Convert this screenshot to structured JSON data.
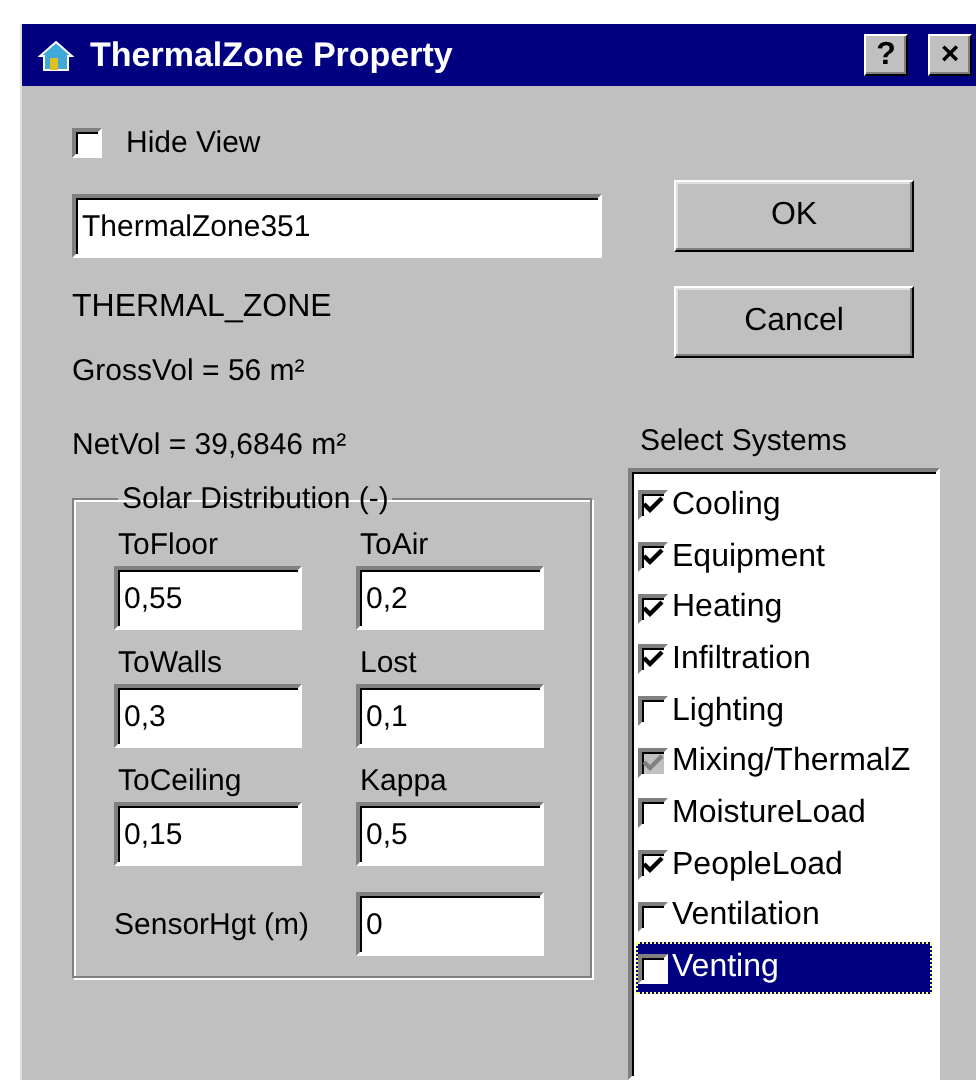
{
  "window": {
    "title": "ThermalZone Property",
    "help_button": "?",
    "close_button": "×"
  },
  "hide_view": {
    "label": "Hide View",
    "checked": false
  },
  "name_field": {
    "value": "ThermalZone351"
  },
  "type_label": "THERMAL_ZONE",
  "gross_vol": "GrossVol = 56 m²",
  "net_vol": "NetVol = 39,6846 m²",
  "solar_distribution": {
    "title": "Solar Distribution (-)",
    "fields": [
      {
        "label": "ToFloor",
        "value": "0,55"
      },
      {
        "label": "ToAir",
        "value": "0,2"
      },
      {
        "label": "ToWalls",
        "value": "0,3"
      },
      {
        "label": "Lost",
        "value": "0,1"
      },
      {
        "label": "ToCeiling",
        "value": "0,15"
      },
      {
        "label": "Kappa",
        "value": "0,5"
      }
    ],
    "sensor": {
      "label": "SensorHgt (m)",
      "value": "0"
    }
  },
  "buttons": [
    "OK",
    "Cancel"
  ],
  "systems": {
    "title": "Select Systems",
    "items": [
      {
        "label": "Cooling",
        "checked": true,
        "disabled": false,
        "selected": false
      },
      {
        "label": "Equipment",
        "checked": true,
        "disabled": false,
        "selected": false
      },
      {
        "label": "Heating",
        "checked": true,
        "disabled": false,
        "selected": false
      },
      {
        "label": "Infiltration",
        "checked": true,
        "disabled": false,
        "selected": false
      },
      {
        "label": "Lighting",
        "checked": false,
        "disabled": false,
        "selected": false
      },
      {
        "label": "Mixing/ThermalZ",
        "checked": true,
        "disabled": true,
        "selected": false
      },
      {
        "label": "MoistureLoad",
        "checked": false,
        "disabled": false,
        "selected": false
      },
      {
        "label": "PeopleLoad",
        "checked": true,
        "disabled": false,
        "selected": false
      },
      {
        "label": "Ventilation",
        "checked": false,
        "disabled": false,
        "selected": false
      },
      {
        "label": "Venting",
        "checked": false,
        "disabled": false,
        "selected": true
      }
    ]
  }
}
